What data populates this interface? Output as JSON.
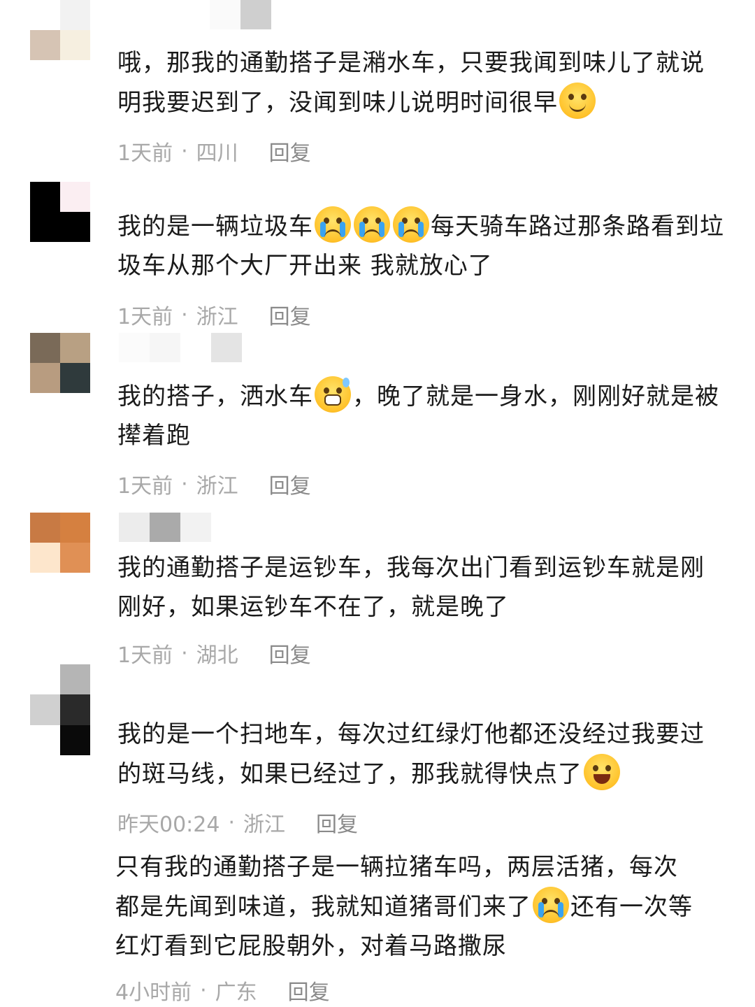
{
  "comments": [
    {
      "text": "哦，那我的通勤搭子是潲水车，只要我闻到味儿了就说明我要迟到了，没闻到味儿说明时间很早",
      "emoji": "dizzy-face-icon",
      "time": "1天前",
      "location": "四川",
      "reply": "回复"
    },
    {
      "text_before": "我的是一辆垃圾车",
      "text_after": "每天骑车路过那条路看到垃圾车从那个大厂开出来 我就放心了",
      "emoji": "crying-face-icon",
      "time": "1天前",
      "location": "浙江",
      "reply": "回复"
    },
    {
      "text_before": "我的搭子，洒水车",
      "text_after": "，晚了就是一身水，刚刚好就是被撵着跑",
      "emoji": "grinning-sweat-icon",
      "time": "1天前",
      "location": "浙江",
      "reply": "回复"
    },
    {
      "text": "我的通勤搭子是运钞车，我每次出门看到运钞车就是刚刚好，如果运钞车不在了，就是晚了",
      "time": "1天前",
      "location": "湖北",
      "reply": "回复"
    },
    {
      "text": "我的是一个扫地车，每次过红绿灯他都还没经过我要过的斑马线，如果已经过了，那我就得快点了",
      "emoji": "laughing-face-icon",
      "time": "昨天00:24",
      "location": "浙江",
      "reply": "回复"
    },
    {
      "text_before": "只有我的通勤搭子是一辆拉猪车吗，两层活猪，每次都是先闻到味道，我就知道猪哥们来了",
      "text_after": "还有一次等红灯看到它屁股朝外，对着马路撒尿",
      "emoji": "loudly-crying-icon",
      "time": "4小时前",
      "location": "广东",
      "reply": "回复"
    }
  ]
}
